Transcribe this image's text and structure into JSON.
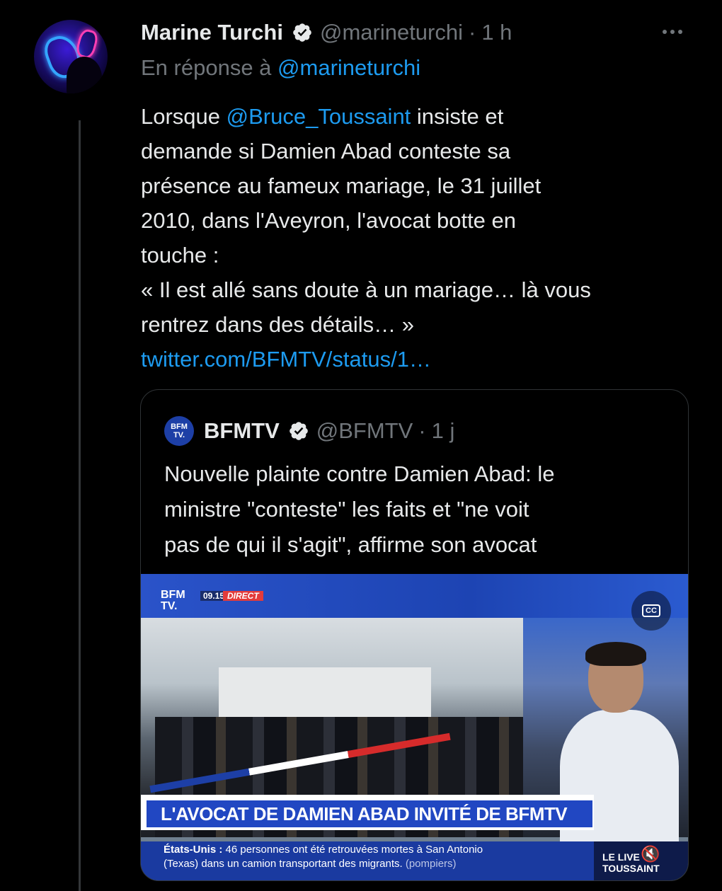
{
  "tweet": {
    "author_name": "Marine Turchi",
    "author_handle": "@marineturchi",
    "separator": "·",
    "time": "1 h",
    "reply_prefix": "En réponse à",
    "reply_to": "@marineturchi",
    "body": {
      "l1_a": "Lorsque ",
      "l1_mention": "@Bruce_Toussaint",
      "l1_b": " insiste et",
      "l2": "demande si Damien Abad conteste sa",
      "l3": "présence au fameux mariage, le 31 juillet",
      "l4": "2010, dans l'Aveyron, l'avocat botte en",
      "l5": "touche :",
      "l6": "« Il est allé sans doute à un mariage… là vous",
      "l7": "rentrez dans des détails… »",
      "link": "twitter.com/BFMTV/status/1…"
    }
  },
  "quote": {
    "avatar_line1": "BFM",
    "avatar_line2": "TV.",
    "author_name": "BFMTV",
    "author_handle": "@BFMTV",
    "separator": "·",
    "time": "1 j",
    "text_l1": "Nouvelle plainte contre Damien Abad: le",
    "text_l2": "ministre \"conteste\" les faits et \"ne voit",
    "text_l3": "pas de qui il s'agit\", affirme son avocat"
  },
  "media": {
    "logo_l1": "BFM",
    "logo_l2": "TV.",
    "clock": "09.15",
    "live_badge": "DIRECT",
    "cc_label": "CC",
    "headline": "L'AVOCAT DE DAMIEN ABAD INVITÉ DE BFMTV",
    "ticker_label": "États-Unis :",
    "ticker_l1": "46 personnes ont été retrouvées mortes à San Antonio",
    "ticker_l2": "(Texas) dans un camion transportant des migrants.",
    "ticker_source": "(pompiers)",
    "show_l1": "LE LIVE",
    "show_l2": "TOUSSAINT",
    "mute_symbol": "🔇"
  },
  "colors": {
    "background": "#000000",
    "text": "#e7e9ea",
    "muted": "#71767b",
    "link": "#1d9bf0",
    "verified": "#e7e9ea",
    "border": "#2f3336",
    "bfm_blue": "#2147c2"
  },
  "icons": {
    "verified": "verified-badge-icon",
    "more": "more-options-icon",
    "cc": "closed-captions-icon",
    "mute": "mute-icon"
  }
}
